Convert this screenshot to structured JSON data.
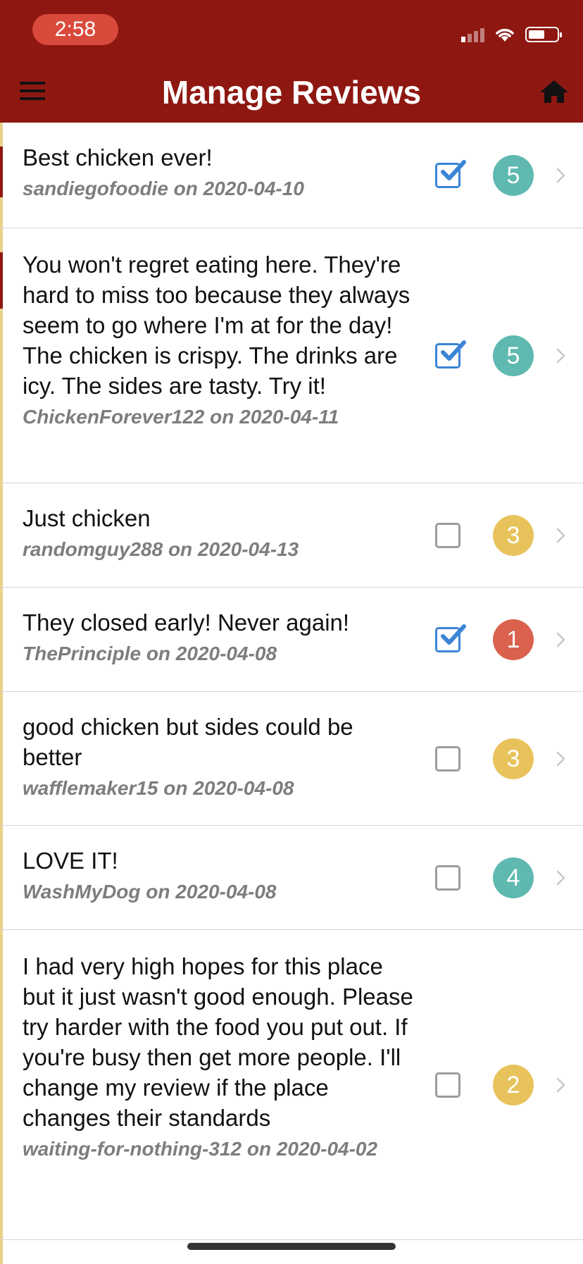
{
  "status_bar": {
    "time": "2:58"
  },
  "header": {
    "title": "Manage Reviews"
  },
  "colors": {
    "header": "#8e1811",
    "badge_green": "#5fb9b0",
    "badge_yellow": "#e8c35c",
    "badge_red": "#d9614e",
    "checkbox_on": "#3b84d6"
  },
  "reviews": [
    {
      "text": "Best chicken ever!",
      "meta": "sandiegofoodie on 2020-04-10",
      "checked": true,
      "rating": "5"
    },
    {
      "text": "You won't regret eating here. They're hard to miss too because they always seem to go where I'm at for the day! The chicken is crispy. The drinks are icy. The sides are tasty. Try it!",
      "meta": "ChickenForever122 on 2020-04-11",
      "checked": true,
      "rating": "5"
    },
    {
      "text": "Just chicken",
      "meta": "randomguy288 on 2020-04-13",
      "checked": false,
      "rating": "3"
    },
    {
      "text": "They closed early! Never again!",
      "meta": "ThePrinciple on 2020-04-08",
      "checked": true,
      "rating": "1"
    },
    {
      "text": "good chicken but sides could be better",
      "meta": "wafflemaker15 on 2020-04-08",
      "checked": false,
      "rating": "3"
    },
    {
      "text": "LOVE IT!",
      "meta": "WashMyDog on 2020-04-08",
      "checked": false,
      "rating": "4"
    },
    {
      "text": "I had very high hopes for this place but it just wasn't good enough. Please try harder with the food you put out. If you're busy then get more people. I'll change my review if the place changes their standards",
      "meta": "waiting-for-nothing-312 on 2020-04-02",
      "checked": false,
      "rating": "2"
    }
  ]
}
